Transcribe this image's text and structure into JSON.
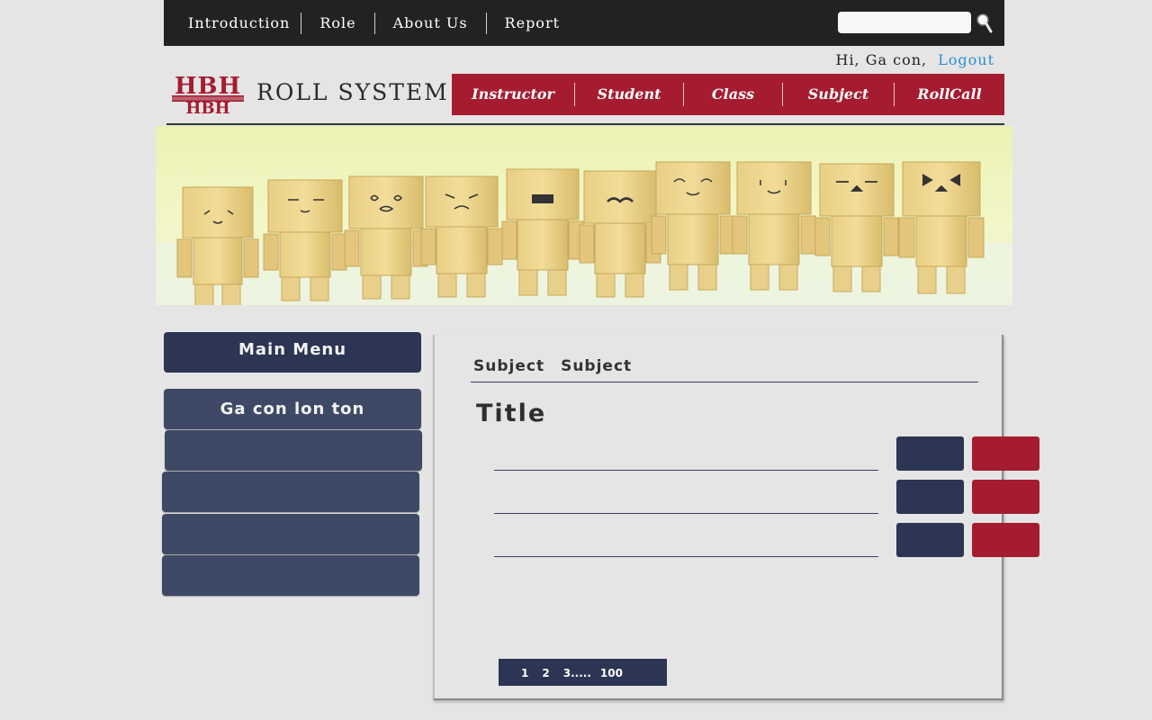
{
  "top_nav": {
    "items": [
      "Introduction",
      "Role",
      "About Us",
      "Report"
    ]
  },
  "search": {
    "value": "",
    "icon": "search-icon"
  },
  "user": {
    "greeting": "Hi, Ga con,",
    "logout": "Logout"
  },
  "brand": {
    "logo_letters": "HBH",
    "title": "ROLL SYSTEM"
  },
  "main_nav": {
    "items": [
      "Instructor",
      "Student",
      "Class",
      "Subject",
      "RollCall"
    ]
  },
  "sidebar": {
    "header": "Main Menu",
    "items": [
      "Ga con lon ton",
      "",
      "",
      "",
      ""
    ]
  },
  "content": {
    "breadcrumb": [
      "Subject",
      "Subject"
    ],
    "title": "Title"
  },
  "pagination": {
    "pages": [
      "1",
      "2",
      "3"
    ],
    "ellipsis": ".....",
    "last": "100"
  },
  "colors": {
    "topbar": "#222222",
    "accent_red": "#a51c30",
    "navy": "#2c3553",
    "sidebar_item": "#3e4a65",
    "link_blue": "#2c8ed6",
    "page_bg": "#e5e5e5"
  }
}
